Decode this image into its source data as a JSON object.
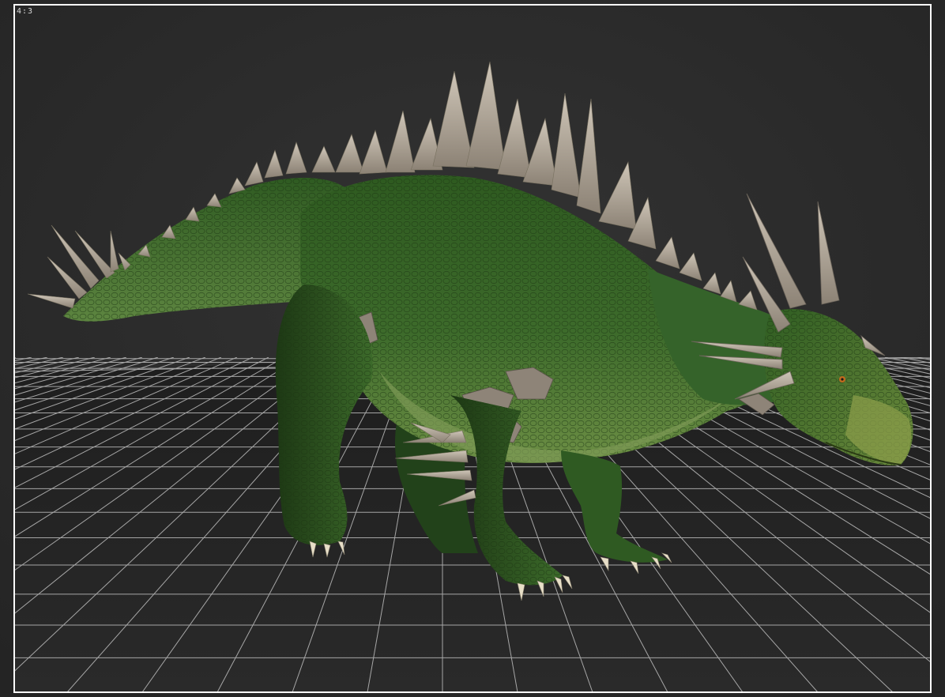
{
  "viewport": {
    "aspect_ratio_label": "4:3",
    "subject": "dinosaur-model"
  },
  "colors": {
    "background": "#2b2b2b",
    "grid_line": "#bdbdbd",
    "frame": "#ffffff",
    "skin_dark": "#1f3d16",
    "skin_mid": "#3f6e2c",
    "skin_light": "#6f9a4d",
    "spike": "#b3a89a",
    "claw": "#e8dfc8"
  }
}
